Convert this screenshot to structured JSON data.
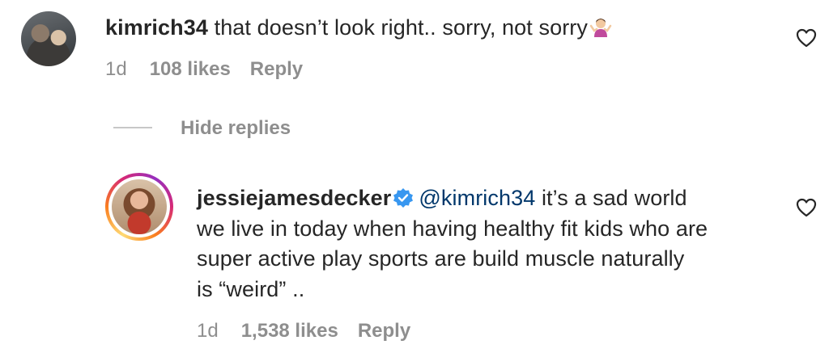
{
  "comment_1": {
    "username": "kimrich34",
    "text": "that doesn’t look right.. sorry, not sorry",
    "emoji": "person-shrugging-emoji",
    "time": "1d",
    "likes": "108 likes",
    "reply_label": "Reply"
  },
  "hide_replies_label": "Hide replies",
  "comment_2": {
    "username": "jessiejamesdecker",
    "verified_icon": "verified-badge-icon",
    "mention": "@kimrich34",
    "line1": "it’s a sad world",
    "line2": "we live in today when having healthy fit kids who are",
    "line3": "super active play sports are build muscle naturally",
    "line4": "is “weird” ..",
    "time": "1d",
    "likes": "1,538 likes",
    "reply_label": "Reply"
  },
  "colors": {
    "text": "#262626",
    "secondary": "#8e8e8e",
    "mention": "#00376b",
    "verified": "#3897f0"
  }
}
